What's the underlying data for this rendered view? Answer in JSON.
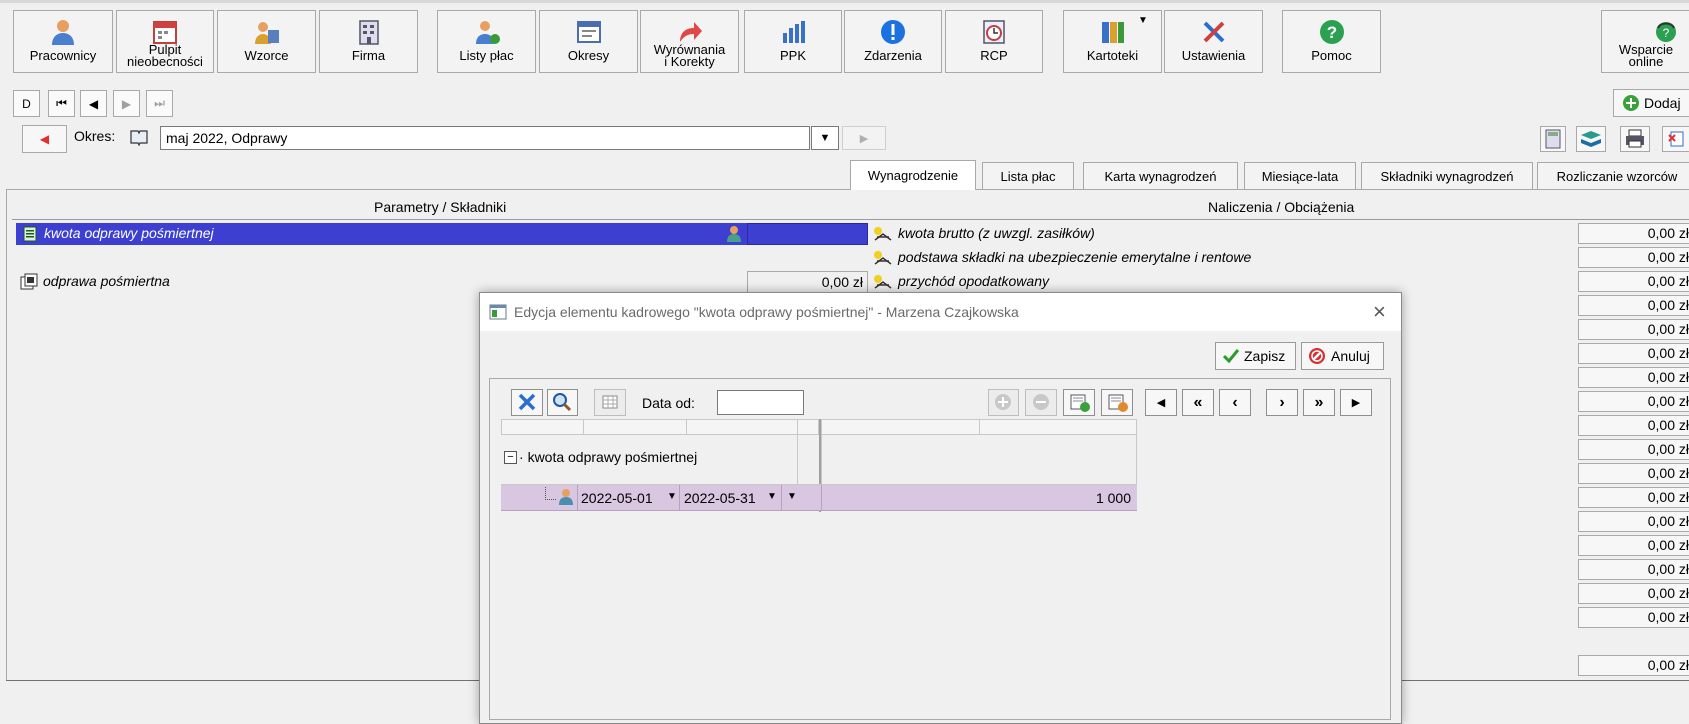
{
  "toolbar": {
    "items": [
      {
        "label": "Pracownicy"
      },
      {
        "label": "Pulpit nieobecności",
        "line1": "Pulpit",
        "line2": "nieobecności"
      },
      {
        "label": "Wzorce"
      },
      {
        "label": "Firma"
      },
      {
        "label": "Listy płac"
      },
      {
        "label": "Okresy"
      },
      {
        "label": "Wyrównania i Korekty",
        "line1": "Wyrównania",
        "line2": "i Korekty"
      },
      {
        "label": "PPK"
      },
      {
        "label": "Zdarzenia"
      },
      {
        "label": "RCP"
      },
      {
        "label": "Kartoteki"
      },
      {
        "label": "Ustawienia"
      },
      {
        "label": "Pomoc"
      },
      {
        "label": "Wsparcie online",
        "line1": "Wsparcie",
        "line2": "online"
      }
    ]
  },
  "nav": {
    "first_label": "D",
    "add_label": "Dodaj"
  },
  "period": {
    "label": "Okres:",
    "value": "maj 2022, Odprawy"
  },
  "tabs": [
    {
      "label": "Wynagrodzenie",
      "active": true
    },
    {
      "label": "Lista płac"
    },
    {
      "label": "Karta wynagrodzeń"
    },
    {
      "label": "Miesiące-lata"
    },
    {
      "label": "Składniki wynagrodzeń"
    },
    {
      "label": "Rozliczanie wzorców"
    }
  ],
  "left_panel": {
    "header": "Parametry / Składniki",
    "rows": [
      {
        "label": "kwota odprawy pośmiertnej",
        "value": "",
        "selected": true
      },
      {
        "label": "odprawa pośmiertna",
        "value": "0,00 zł"
      }
    ]
  },
  "right_panel": {
    "header": "Naliczenia / Obciążenia",
    "rows": [
      {
        "label": "kwota brutto (z uwzgl. zasiłków)"
      },
      {
        "label": "podstawa składki na ubezpieczenie emerytalne i rentowe"
      },
      {
        "label": "przychód opodatkowany"
      }
    ],
    "values": [
      "0,00 zł",
      "0,00 zł",
      "0,00 zł",
      "0,00 zł",
      "0,00 zł",
      "0,00 zł",
      "0,00 zł",
      "0,00 zł",
      "0,00 zł",
      "0,00 zł",
      "0,00 zł",
      "0,00 zł",
      "0,00 zł",
      "0,00 zł",
      "0,00 zł",
      "0,00 zł",
      "0,00 zł",
      "0,00 zł"
    ]
  },
  "dialog": {
    "title": "Edycja elementu kadrowego \"kwota odprawy pośmiertnej\" - Marzena Czajkowska",
    "save_label": "Zapisz",
    "cancel_label": "Anuluj",
    "date_from_label": "Data od:",
    "date_from_value": "",
    "tree_node": "kwota odprawy pośmiertnej",
    "row": {
      "date_from": "2022-05-01",
      "date_to": "2022-05-31",
      "amount": "1 000"
    }
  },
  "colors": {
    "selection": "#3c3fcf",
    "grid_row": "#d9c6e0",
    "accent_red": "#e03030"
  }
}
